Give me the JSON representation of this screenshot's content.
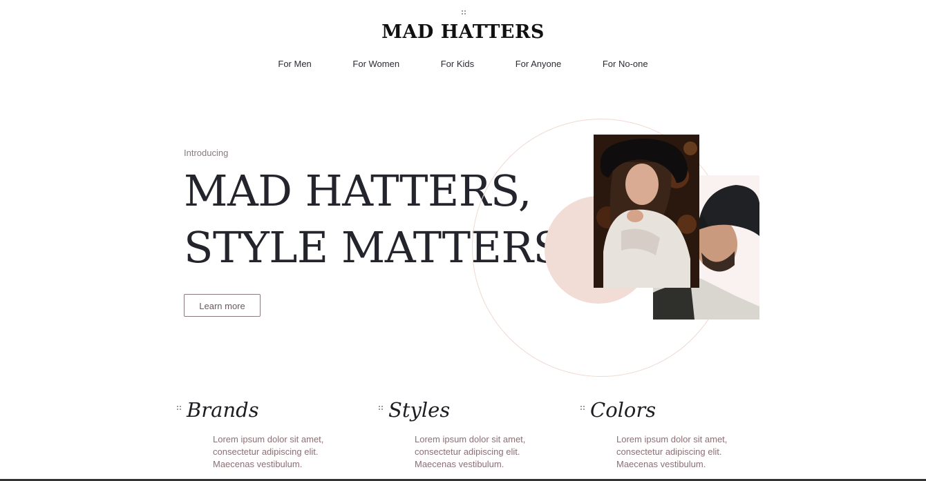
{
  "brand": {
    "logo_text": "MAD HATTERS"
  },
  "nav": {
    "items": [
      {
        "label": "For Men"
      },
      {
        "label": "For Women"
      },
      {
        "label": "For Kids"
      },
      {
        "label": "For Anyone"
      },
      {
        "label": "For No-one"
      }
    ]
  },
  "hero": {
    "eyebrow": "Introducing",
    "headline_line1": "MAD HATTERS,",
    "headline_line2": "STYLE MATTERS",
    "cta_label": "Learn more",
    "images": [
      {
        "alt": "woman-in-hat-photo"
      },
      {
        "alt": "man-in-cap-photo"
      }
    ]
  },
  "sections": [
    {
      "title": "Brands",
      "text_lines": [
        "Lorem ipsum dolor sit amet,",
        "consectetur adipiscing elit.",
        "Maecenas vestibulum."
      ]
    },
    {
      "title": "Styles",
      "text_lines": [
        "Lorem ipsum dolor sit amet,",
        "consectetur adipiscing elit.",
        "Maecenas vestibulum."
      ]
    },
    {
      "title": "Colors",
      "text_lines": [
        "Lorem ipsum dolor sit amet,",
        "consectetur adipiscing elit.",
        "Maecenas vestibulum."
      ]
    }
  ],
  "colors": {
    "accent_blush": "#f2ddd6",
    "text_dark": "#24242c",
    "text_muted": "#8a6f74"
  }
}
